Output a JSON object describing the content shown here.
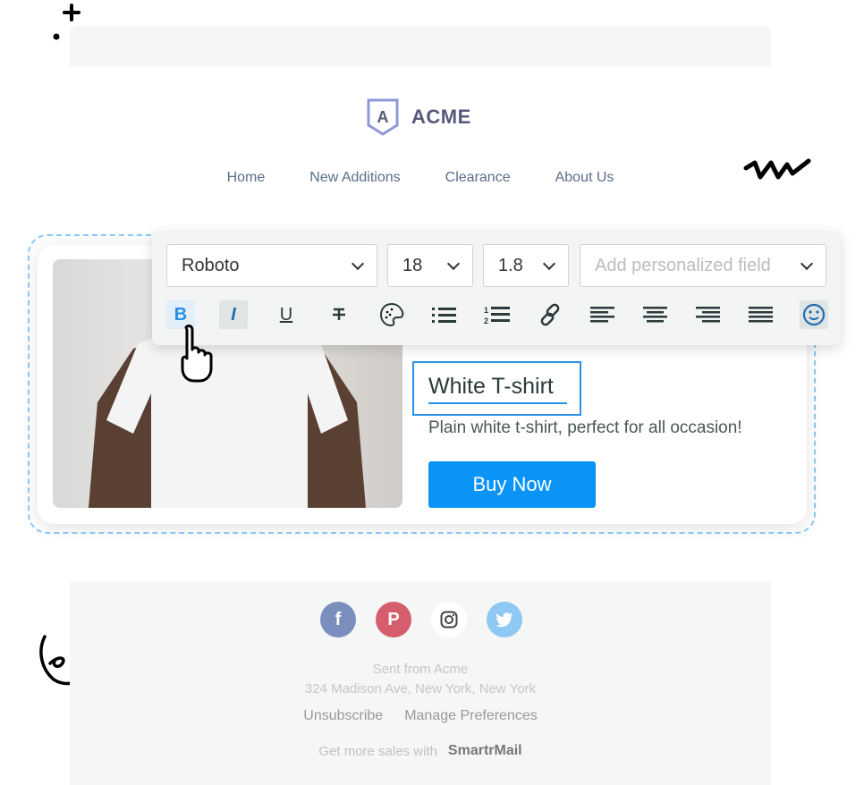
{
  "brand": {
    "name": "ACME",
    "logo_letter": "A"
  },
  "nav": [
    "Home",
    "New Additions",
    "Clearance",
    "About Us"
  ],
  "toolbar": {
    "font": "Roboto",
    "size": "18",
    "line_height": "1.8",
    "personalize_placeholder": "Add personalized field",
    "buttons": [
      "bold",
      "italic",
      "underline",
      "strikethrough",
      "color-palette",
      "bullet-list",
      "numbered-list",
      "link",
      "align-left",
      "align-center",
      "align-right",
      "align-justify",
      "emoji"
    ],
    "bold_label": "B",
    "italic_label": "I",
    "underline_label": "U"
  },
  "product": {
    "title": "White T-shirt",
    "description": "Plain white t-shirt, perfect for all occasion!",
    "cta": "Buy Now"
  },
  "footer": {
    "social": [
      "facebook",
      "pinterest",
      "instagram",
      "twitter"
    ],
    "sent_from": "Sent from Acme",
    "address": "324 Madison Ave, New York, New York",
    "unsubscribe": "Unsubscribe",
    "manage": "Manage Preferences",
    "promo": "Get more sales with",
    "promo_brand": "SmartrMail"
  },
  "colors": {
    "accent": "#0a94f7",
    "facebook": "#7b8fbf",
    "pinterest": "#d65d6b",
    "twitter": "#8ec9f3"
  }
}
